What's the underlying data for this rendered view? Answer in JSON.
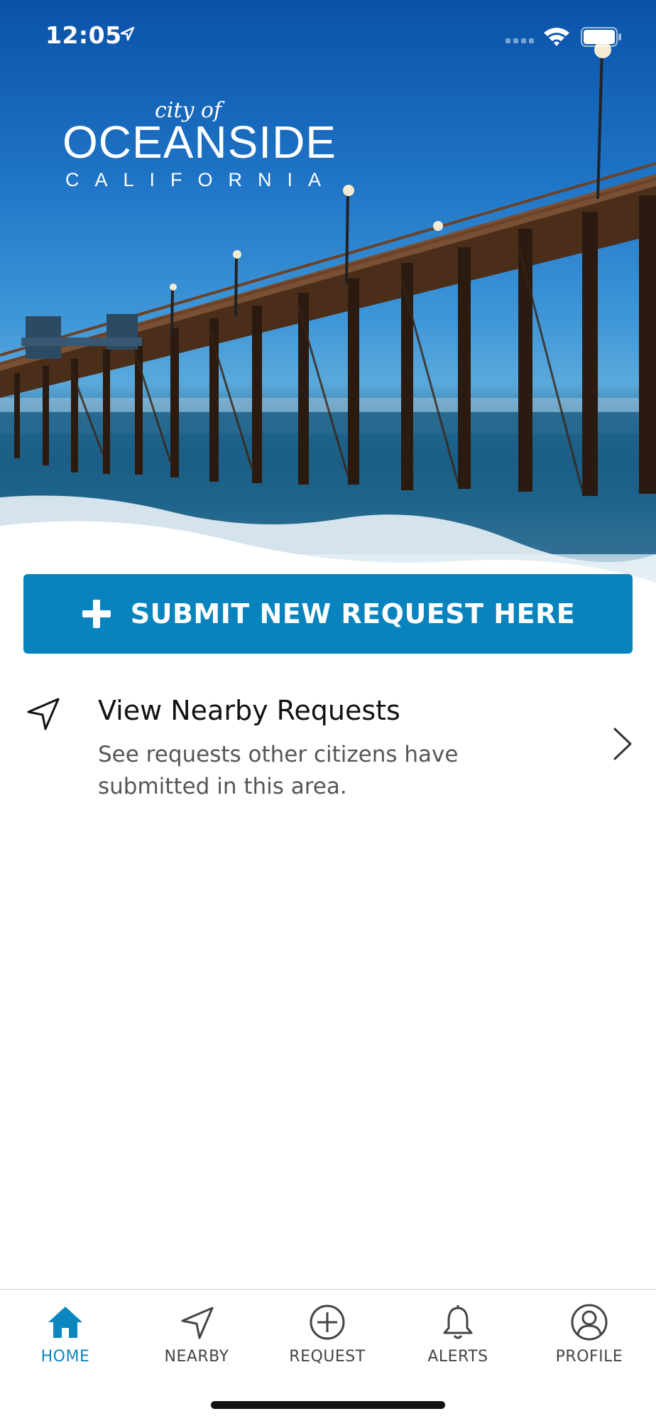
{
  "status_bar": {
    "time": "12:05",
    "icons": [
      "location-arrow-icon",
      "cell-signal-icon",
      "wifi-icon",
      "battery-icon"
    ]
  },
  "logo": {
    "city_of": "city of",
    "name": "OCEANSIDE",
    "state": "CALIFORNIA"
  },
  "submit_button": {
    "label": "SUBMIT NEW REQUEST HERE",
    "icon": "plus-icon",
    "color": "#0883bd"
  },
  "nearby": {
    "title": "View Nearby Requests",
    "subtitle": "See requests other citizens have submitted in this area.",
    "icon": "navigation-arrow-icon",
    "chevron": "chevron-right-icon"
  },
  "tab_bar": {
    "active_color": "#0b86bf",
    "inactive_color": "#444444",
    "tabs": [
      {
        "label": "HOME",
        "icon": "home-icon",
        "active": true
      },
      {
        "label": "NEARBY",
        "icon": "navigation-arrow-icon",
        "active": false
      },
      {
        "label": "REQUEST",
        "icon": "plus-circle-icon",
        "active": false
      },
      {
        "label": "ALERTS",
        "icon": "bell-icon",
        "active": false
      },
      {
        "label": "PROFILE",
        "icon": "user-circle-icon",
        "active": false
      }
    ]
  }
}
